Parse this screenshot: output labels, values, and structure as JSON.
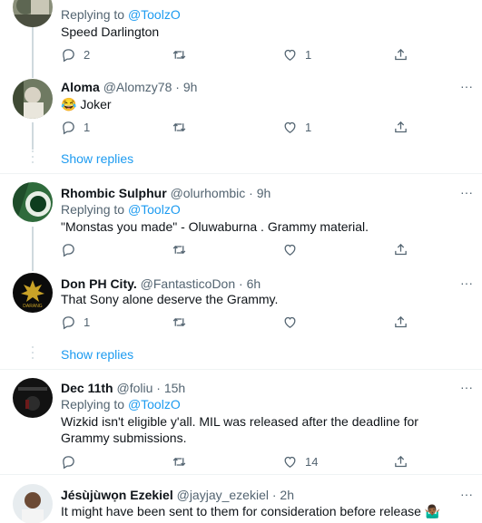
{
  "tweets": [
    {
      "reply_prefix": "Replying to",
      "reply_mention": "@ToolzO",
      "text": "Speed Darlington",
      "reply_count": "2",
      "retweet_count": "",
      "like_count": "1"
    },
    {
      "name": "Aloma",
      "handle": "@Alomzy78",
      "time": "· 9h",
      "text": "😂 Joker",
      "reply_count": "1",
      "retweet_count": "",
      "like_count": "1"
    },
    {
      "name": "Rhombic Sulphur",
      "handle": "@olurhombic",
      "time": "· 9h",
      "reply_prefix": "Replying to",
      "reply_mention": "@ToolzO",
      "text": "\"Monstas you made\" - Oluwaburna . Grammy material.",
      "reply_count": "",
      "retweet_count": "",
      "like_count": ""
    },
    {
      "name": "Don PH City.",
      "handle": "@FantasticoDon",
      "time": "· 6h",
      "text": "That Sony alone deserve the Grammy.",
      "reply_count": "1",
      "retweet_count": "",
      "like_count": ""
    },
    {
      "name": "Dec 11th",
      "handle": "@foliu",
      "time": "· 15h",
      "reply_prefix": "Replying to",
      "reply_mention": "@ToolzO",
      "text": "Wizkid isn't eligible y'all. MIL was released after the deadline for Grammy submissions.",
      "reply_count": "",
      "retweet_count": "",
      "like_count": "14"
    },
    {
      "name": "Jésùjùwọn Ezekiel",
      "handle": "@jayjay_ezekiel",
      "time": "· 2h",
      "text": "It might have been sent to them for consideration before release 🤷🏾‍♂️"
    }
  ],
  "show_replies_label": "Show replies",
  "more_glyph": "···",
  "colors": {
    "accent": "#1d9bf0",
    "muted": "#536471",
    "text": "#0f1419",
    "divider": "#eff3f4"
  },
  "icons": [
    "reply-icon",
    "retweet-icon",
    "like-icon",
    "share-icon",
    "more-icon"
  ]
}
